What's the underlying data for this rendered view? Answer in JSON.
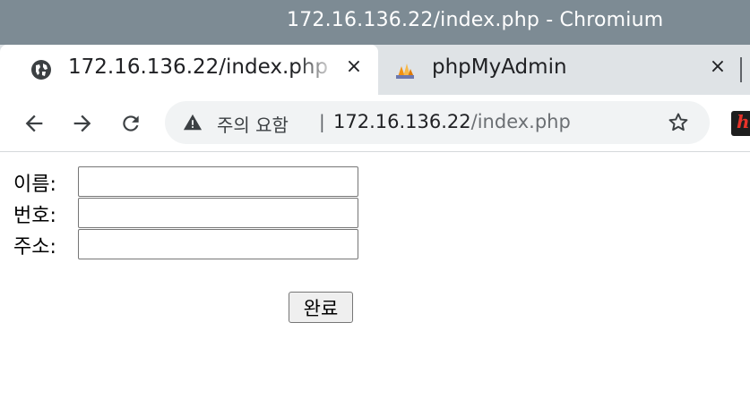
{
  "window": {
    "title": "172.16.136.22/index.php - Chromium"
  },
  "tabs": [
    {
      "label": "172.16.136.22/index.php",
      "close": "×",
      "icon": "globe-icon",
      "active": true
    },
    {
      "label": "phpMyAdmin",
      "close": "×",
      "icon": "phpmyadmin-logo-icon",
      "active": false
    }
  ],
  "toolbar": {
    "back_icon": "back-arrow-icon",
    "forward_icon": "forward-arrow-icon",
    "reload_icon": "reload-icon",
    "security_label": "주의 요함",
    "divider": "|",
    "url_host": "172.16.136.22",
    "url_path": "/index.php",
    "bookmark_icon": "star-icon",
    "extension_glyph": "h"
  },
  "form": {
    "fields": [
      {
        "label": "이름:",
        "value": "",
        "placeholder": ""
      },
      {
        "label": "번호:",
        "value": "",
        "placeholder": ""
      },
      {
        "label": "주소:",
        "value": "",
        "placeholder": ""
      }
    ],
    "submit_label": "완료"
  },
  "colors": {
    "titlebar": "#7d8b94",
    "tabstrip": "#dfe3e6",
    "omnibox": "#f1f3f4",
    "extension_red": "#e8332a"
  }
}
